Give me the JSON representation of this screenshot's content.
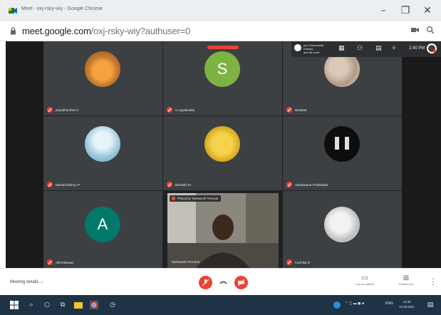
{
  "window": {
    "title": "Meet - oxj-rsky-wiy - Google Chrome",
    "minimize": "–",
    "maximize": "❐",
    "close": "✕"
  },
  "address": {
    "domain": "meet.google.com",
    "path": "/oxj-rsky-wiy?authuser=0"
  },
  "header": {
    "presenter_line1": "you (Yashwanth Kumar)",
    "presenter_line2": "and 46 more",
    "time": "2:40 PM",
    "icons": [
      "people-icon",
      "chat-icon",
      "activities-icon",
      "info-icon"
    ]
  },
  "participants": [
    {
      "name": "priyadharshini C",
      "avatar": "photo"
    },
    {
      "name": "s.s.jayakodey",
      "letter": "S",
      "avatar_color": "#7cb342"
    },
    {
      "name": "Bhaskar",
      "avatar": "photo"
    },
    {
      "name": "Mohadi Bishnu P",
      "avatar": "photo"
    },
    {
      "name": "Bharathi M",
      "avatar": "photo"
    },
    {
      "name": "Vettaswaran Prabhakar",
      "avatar": "photo"
    },
    {
      "name": "Akhil Biswas",
      "letter": "A",
      "avatar_color": "#00796b"
    },
    {
      "name": "Karthika R",
      "avatar": "photo"
    }
  ],
  "video": {
    "banner": "Pinned by Yashwanth Perumal",
    "name": "Yashwanth Perumal"
  },
  "bottom": {
    "meeting_details": "Meeting details",
    "captions_label": "Turn on captions",
    "present_label": "Present now"
  },
  "taskbar": {
    "lang": "ENG",
    "time": "14:40",
    "date": "12-03-2021"
  },
  "colors": {
    "accent_red": "#ea4335",
    "stage": "#202124",
    "tile": "#3c4043",
    "taskbar": "#1f3346"
  }
}
